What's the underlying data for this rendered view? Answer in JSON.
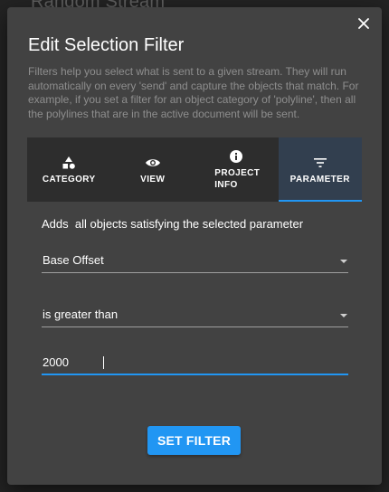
{
  "background": {
    "stream_title": "Random Stream"
  },
  "dialog": {
    "title": "Edit Selection Filter",
    "close_icon": "close-icon",
    "description": "Filters help you select what is sent to a given stream. They will run automatically on every 'send' and capture the objects that match. For example, if you set a filter for an object category of 'polyline', then all the polylines that are in the active document will be sent."
  },
  "tabs": [
    {
      "label": "CATEGORY",
      "icon": "shapes-icon",
      "active": false
    },
    {
      "label": "VIEW",
      "icon": "eye-icon",
      "active": false
    },
    {
      "label": "PROJECT INFO",
      "icon": "info-icon",
      "active": false
    },
    {
      "label": "PARAMETER",
      "icon": "filter-icon",
      "active": true
    }
  ],
  "parameter": {
    "adds_text": "Adds  all objects satisfying the selected parameter",
    "parameter_select": "Base Offset",
    "operator_select": "is greater than",
    "value_input": "2000"
  },
  "actions": {
    "set_filter_label": "SET FILTER"
  },
  "colors": {
    "accent": "#2196f3",
    "dialog_bg": "#424242",
    "tab_bar_bg": "#2d2d2d",
    "active_tab_bg": "#323f4f"
  }
}
